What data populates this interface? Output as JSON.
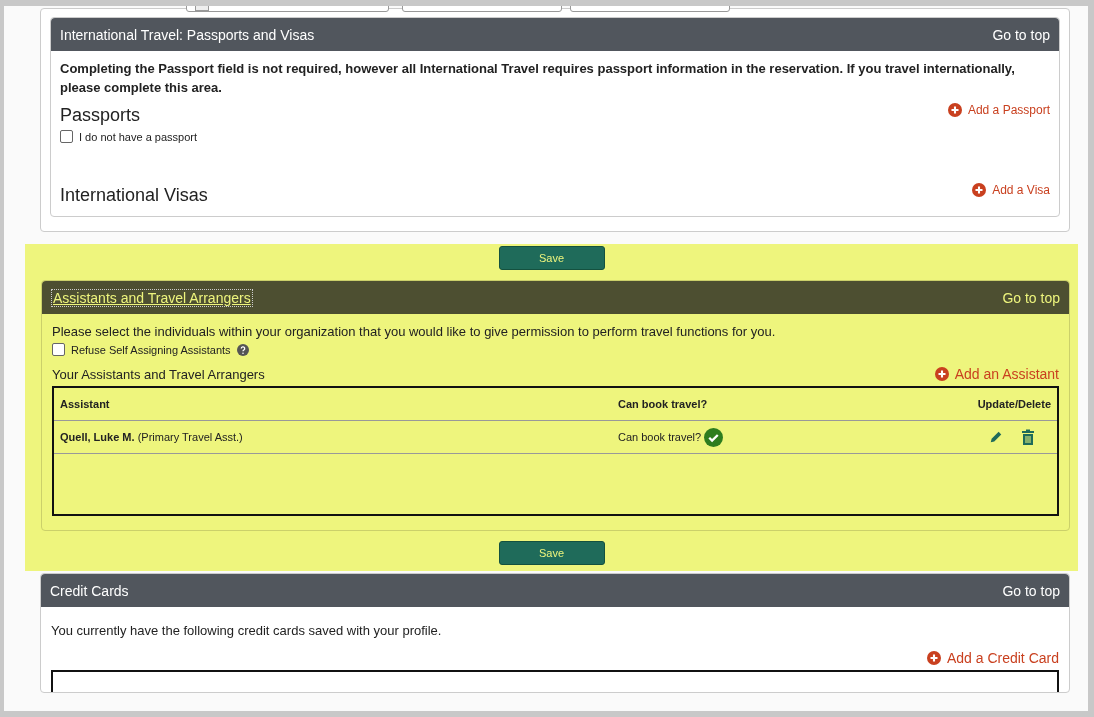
{
  "passports_section": {
    "title": "International Travel: Passports and Visas",
    "go_to_top": "Go to top",
    "notice": "Completing the Passport field is not required, however all International Travel requires passport information in the reservation. If you travel internationally, please complete this area.",
    "passports_heading": "Passports",
    "add_passport": "Add a Passport",
    "no_passport": {
      "label": "I do not have a passport",
      "checked": false
    },
    "visas_heading": "International Visas",
    "add_visa": "Add a Visa"
  },
  "save_top": "Save",
  "assistants_section": {
    "title": "Assistants and Travel Arrangers",
    "go_to_top": "Go to top",
    "intro": "Please select the individuals within your organization that you would like to give permission to perform travel functions for you.",
    "refuse_self": {
      "label": "Refuse Self Assigning Assistants",
      "checked": false
    },
    "list_heading": "Your Assistants and Travel Arrangers",
    "add_assistant": "Add an Assistant",
    "columns": [
      "Assistant",
      "Can book travel?",
      "Update/Delete"
    ],
    "rows": [
      {
        "name": "Quell, Luke M.",
        "role": "(Primary Travel Asst.)",
        "can_book_label": "Can book travel?",
        "can_book": true
      }
    ]
  },
  "save_bottom": "Save",
  "credit_cards_section": {
    "title": "Credit Cards",
    "go_to_top": "Go to top",
    "intro": "You currently have the following credit cards saved with your profile.",
    "add_card": "Add a Credit Card"
  }
}
